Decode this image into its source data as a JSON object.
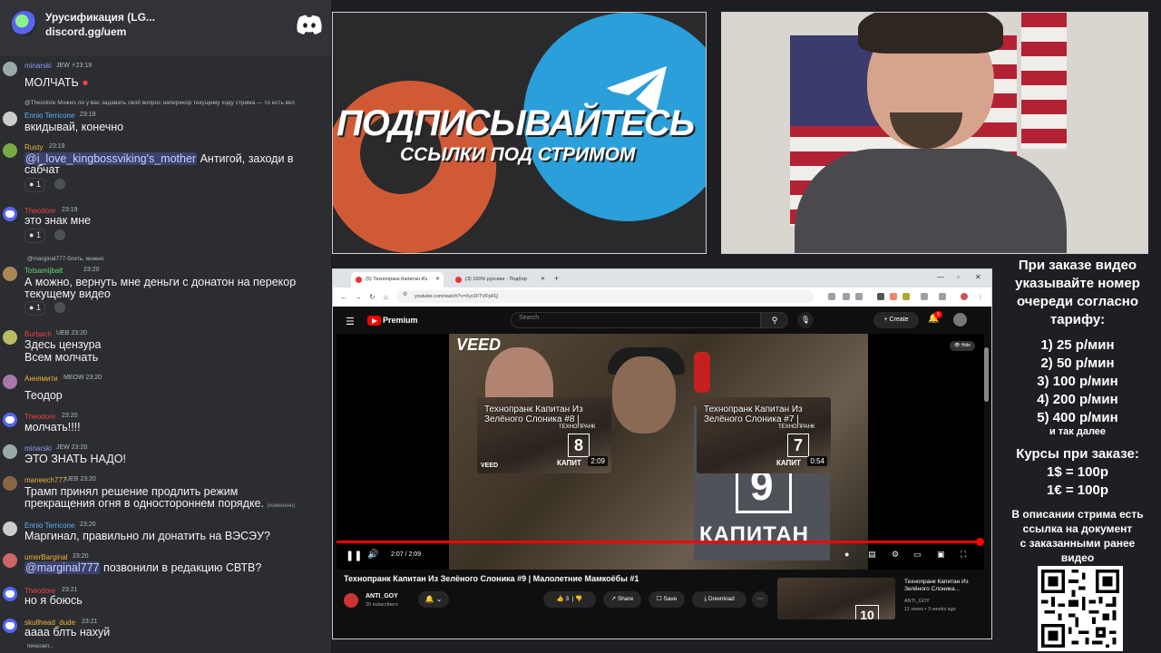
{
  "discord": {
    "server_name": "Урусификация (LG...",
    "server_invite": "discord.gg/uem",
    "typing": "печатает...",
    "messages": [
      {
        "user": "minarski",
        "user_color": "#8e9cf0",
        "badges": "JEW ⚡23:19",
        "text": "МОЛЧАТЬ",
        "avatar": "#9aa"
      },
      {
        "reply": "@Theodore Можно ли у вас задавать свой вопрос наперекор текущему ходу стрима — то есть вкл"
      },
      {
        "user": "Ennio Terricone",
        "user_color": "#5ab0ff",
        "badges": "23:19",
        "text": "вкидывай, конечно",
        "avatar": "#ccc"
      },
      {
        "user": "Rusty",
        "user_color": "#f0b232",
        "badges": "23:19",
        "mention": "@i_love_kingbossviking's_mother",
        "text": "Антигой, заходи в",
        "text2": "сабчат",
        "react_count": "1",
        "avatar": "#7a4"
      },
      {
        "user": "Theodore",
        "user_color": "#f23f43",
        "badges": "23:19",
        "text": "это знак мне",
        "react_count": "1",
        "avatar": "discord"
      },
      {
        "reply": "@marginal777 блять. можно"
      },
      {
        "user": "Totsamijbalt",
        "user_color": "#6fd36f",
        "badges": "23:20",
        "text": "А можно, вернуть мне деньги с донатон на перекор",
        "text2": "текущему видео",
        "react_count": "1",
        "avatar": "#a85"
      },
      {
        "user": "Burbach",
        "user_color": "#f23f43",
        "badges": "UEB 23:20",
        "text": "Здесь цензура",
        "text2": "Всем молчать",
        "avatar": "#bb6"
      },
      {
        "user": "Аннямити",
        "user_color": "#f0b232",
        "badges": "MEOW 23:20",
        "text": "Теодор",
        "avatar": "#a7a"
      },
      {
        "user": "Theodore",
        "user_color": "#f23f43",
        "badges": "23:20",
        "text": "молчать!!!!",
        "avatar": "discord"
      },
      {
        "user": "minarski",
        "user_color": "#8e9cf0",
        "badges": "JEW 23:20",
        "text": "ЭТО ЗНАТЬ НАДО!",
        "avatar": "#9aa"
      },
      {
        "user": "maneech777",
        "user_color": "#f0b232",
        "badges": "UEB 23:20",
        "text": "Трамп принял решение продлить режим",
        "text2": "прекращения огня в одностороннем порядке.",
        "edited": "(изменено)",
        "avatar": "#864"
      },
      {
        "user": "Ennio Terricone",
        "user_color": "#5ab0ff",
        "badges": "23:20",
        "text": "Маргинал, правильно ли донатить на ВЭСЭУ?",
        "avatar": "#ccc"
      },
      {
        "user": "umerBarginal",
        "user_color": "#f0b232",
        "badges": "23:20",
        "mention": "@marginal777",
        "text": "позвонили в редакцию СВТВ?",
        "avatar": "#c66"
      },
      {
        "user": "Theodore",
        "user_color": "#f23f43",
        "badges": "23:21",
        "text": "но я боюсь",
        "avatar": "discord"
      },
      {
        "user": "skullhead_dude",
        "user_color": "#f0b232",
        "badges": "23:21",
        "text": "аааа блть нахуй",
        "avatar": "discord"
      }
    ]
  },
  "promo": {
    "title": "ПОДПИСЫВАЙТЕСЬ",
    "subtitle": "ССЫЛКИ ПОД СТРИМОМ",
    "colors": {
      "telegram": "#2a9fd9",
      "patreon": "#d05a36"
    }
  },
  "browser": {
    "tabs": [
      {
        "label": "(5) Технопранк Капитан Из",
        "active": true
      },
      {
        "label": "(3) 100% русские · Подбор",
        "active": false
      }
    ],
    "url": "youtube.com/watch?v=Xyr2FTVFpFQ",
    "youtube": {
      "brand": "Premium",
      "search_placeholder": "Search",
      "create_label": "Create",
      "notif_count": "5",
      "hide_label": "Hide",
      "veed": "VEED",
      "big_number": "9",
      "big_caption": "КАПИТАН",
      "end_cards": [
        {
          "title": "Технопранк Капитан Из Зелёного Слоника #8 |",
          "num": "8",
          "overlay": "ТЕХНОПРАНК",
          "caption": "КАПИТ",
          "duration": "2:09",
          "veed": "VEED"
        },
        {
          "title": "Технопранк Капитан Из Зелёного Слоника #7 |",
          "num": "7",
          "overlay": "ТЕХНОПРАНК",
          "caption": "КАПИТ",
          "duration": "0:54",
          "veed": ""
        }
      ],
      "progress_fraction": 1.0,
      "time": "2:07 / 2:09",
      "video_title": "Технопранк Капитан Из Зелёного Слоника #9 | Малолетние Мамкоёбы #1",
      "channel_name": "ANTI_GOY",
      "channel_subs": "20 subscribers",
      "like_count": "3",
      "share_label": "Share",
      "save_label": "Save",
      "download_label": "Download",
      "suggested": {
        "title": "Технопранк Капитан Из Зелёного Слоника...",
        "channel": "ANTI_GOY",
        "meta": "11 views • 3 weeks ago",
        "num": "10"
      }
    }
  },
  "pricing": {
    "intro": [
      "При заказе видео",
      "указывайте номер",
      "очереди согласно",
      "тарифу:"
    ],
    "tiers": [
      "1) 25 р/мин",
      "2) 50 р/мин",
      "3) 100 р/мин",
      "4) 200 р/мин",
      "5) 400 р/мин"
    ],
    "etc": "и так далее",
    "rates_title": "Курсы при заказе:",
    "rates": [
      "1$ = 100р",
      "1€ = 100р"
    ],
    "footer": [
      "В описании стрима есть",
      "ссылка на документ",
      "с заказанными ранее",
      "видео"
    ]
  }
}
